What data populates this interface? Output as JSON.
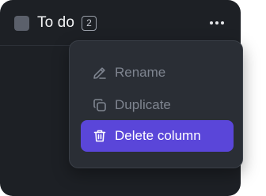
{
  "column": {
    "title": "To do",
    "count": "2",
    "color": "#5b606b"
  },
  "menu": {
    "items": [
      {
        "label": "Rename",
        "icon": "pencil-icon"
      },
      {
        "label": "Duplicate",
        "icon": "duplicate-icon"
      },
      {
        "label": "Delete column",
        "icon": "trash-icon",
        "highlighted": true
      }
    ],
    "highlight_color": "#5a46d9"
  }
}
